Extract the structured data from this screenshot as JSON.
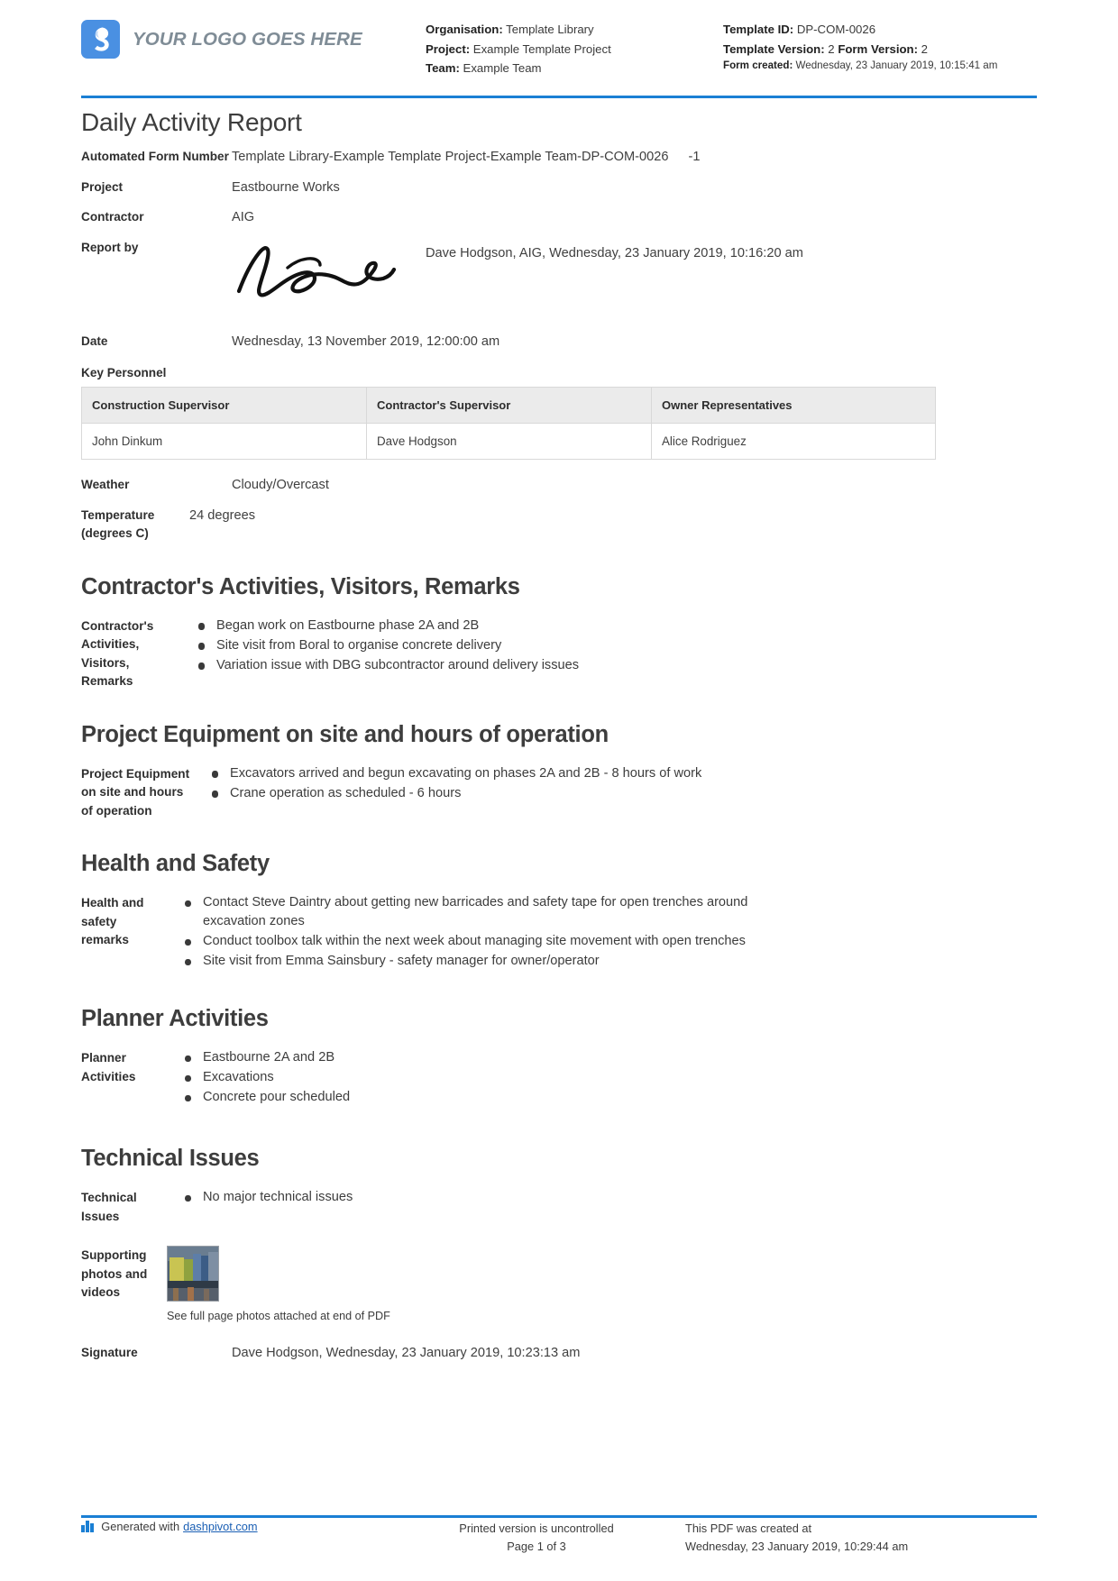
{
  "header": {
    "logo_text": "YOUR LOGO GOES HERE",
    "logo_color": "#4a90e2",
    "accent_color": "#1a7fd4",
    "meta_left": [
      {
        "label": "Organisation:",
        "value": "Template Library"
      },
      {
        "label": "Project:",
        "value": "Example Template Project"
      },
      {
        "label": "Team:",
        "value": "Example Team"
      }
    ],
    "meta_right": {
      "template_id_label": "Template ID:",
      "template_id_value": "DP-COM-0026",
      "template_version_label": "Template Version:",
      "template_version_value": "2",
      "form_version_label": "Form Version:",
      "form_version_value": "2",
      "form_created_label": "Form created:",
      "form_created_value": "Wednesday, 23 January 2019, 10:15:41 am"
    }
  },
  "document": {
    "title": "Daily Activity Report",
    "fields": {
      "automated_form_number_label": "Automated Form Number",
      "automated_form_number_value": "Template Library-Example Template Project-Example Team-DP-COM-0026",
      "automated_form_number_suffix": "-1",
      "project_label": "Project",
      "project_value": "Eastbourne Works",
      "contractor_label": "Contractor",
      "contractor_value": "AIG",
      "report_by_label": "Report by",
      "report_by_value": "Dave Hodgson, AIG, Wednesday, 23 January 2019, 10:16:20 am",
      "report_by_signature": "handwritten-signature",
      "date_label": "Date",
      "date_value": "Wednesday, 13 November 2019, 12:00:00 am",
      "weather_label": "Weather",
      "weather_value": "Cloudy/Overcast",
      "temperature_label": "Temperature (degrees C)",
      "temperature_value": "24 degrees"
    },
    "key_personnel": {
      "title": "Key Personnel",
      "columns": [
        "Construction Supervisor",
        "Contractor's Supervisor",
        "Owner Representatives"
      ],
      "rows": [
        [
          "John Dinkum",
          "Dave Hodgson",
          "Alice Rodriguez"
        ]
      ]
    },
    "sections": [
      {
        "heading": "Contractor's Activities, Visitors, Remarks",
        "field_label": "Contractor's Activities, Visitors, Remarks",
        "bullets": [
          "Began work on Eastbourne phase 2A and 2B",
          "Site visit from Boral to organise concrete delivery",
          "Variation issue with DBG subcontractor around delivery issues"
        ]
      },
      {
        "heading": "Project Equipment on site and hours of operation",
        "field_label": "Project Equipment on site and hours of operation",
        "bullets": [
          "Excavators arrived and begun excavating on phases 2A and 2B - 8 hours of work",
          "Crane operation as scheduled - 6 hours"
        ]
      },
      {
        "heading": "Health and Safety",
        "field_label": "Health and safety remarks",
        "bullets": [
          "Contact Steve Daintry about getting new barricades and safety tape for open trenches around excavation zones",
          "Conduct toolbox talk within the next week about managing site movement with open trenches",
          "Site visit from Emma Sainsbury - safety manager for owner/operator"
        ]
      },
      {
        "heading": "Planner Activities",
        "field_label": "Planner Activities",
        "bullets": [
          "Eastbourne 2A and 2B",
          "Excavations",
          "Concrete pour scheduled"
        ]
      },
      {
        "heading": "Technical Issues",
        "field_label": "Technical Issues",
        "bullets": [
          "No major technical issues"
        ]
      }
    ],
    "supporting": {
      "label": "Supporting photos and videos",
      "thumbnail": "site-photo-thumbnail",
      "caption": "See full page photos attached at end of PDF"
    },
    "signature": {
      "label": "Signature",
      "value": "Dave Hodgson, Wednesday, 23 January 2019, 10:23:13 am"
    }
  },
  "footer": {
    "generated_prefix": "Generated with",
    "generated_link": "dashpivot.com",
    "printed_line1": "Printed version is uncontrolled",
    "printed_line2": "Page 1 of 3",
    "created_line1": "This PDF was created at",
    "created_line2": "Wednesday, 23 January 2019, 10:29:44 am"
  }
}
